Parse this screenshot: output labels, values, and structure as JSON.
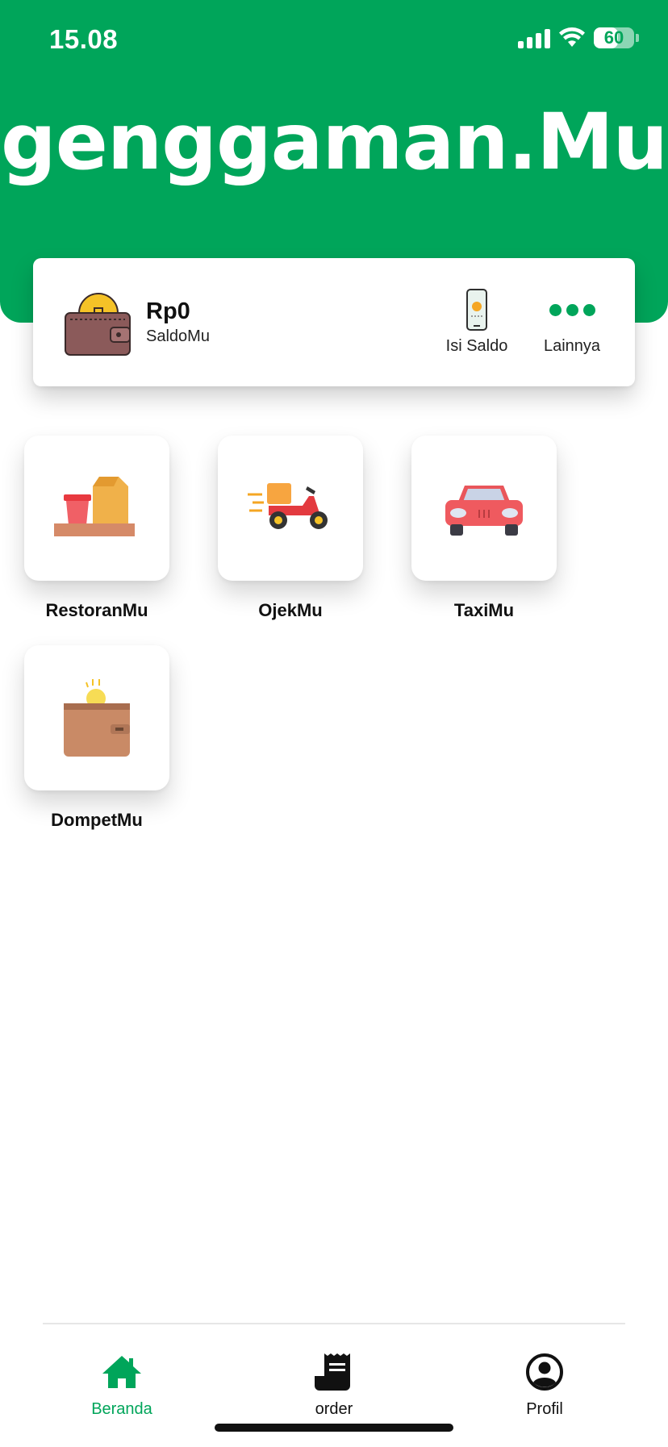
{
  "status_bar": {
    "time": "15.08",
    "battery": "60"
  },
  "header": {
    "logo_text": "genggaman.Mu"
  },
  "balance_card": {
    "amount": "Rp0",
    "label": "SaldoMu",
    "actions": [
      {
        "label": "Isi Saldo",
        "icon": "phone-topup-icon"
      },
      {
        "label": "Lainnya",
        "icon": "more-dots-icon"
      }
    ]
  },
  "services": [
    {
      "label": "RestoranMu",
      "icon": "restaurant-food-icon"
    },
    {
      "label": "OjekMu",
      "icon": "scooter-delivery-icon"
    },
    {
      "label": "TaxiMu",
      "icon": "car-icon"
    },
    {
      "label": "DompetMu",
      "icon": "wallet-coin-icon"
    }
  ],
  "bottom_nav": [
    {
      "label": "Beranda",
      "icon": "home-icon",
      "active": true
    },
    {
      "label": "order",
      "icon": "receipt-icon",
      "active": false
    },
    {
      "label": "Profil",
      "icon": "profile-icon",
      "active": false
    }
  ],
  "colors": {
    "brand_green": "#00a55a",
    "text": "#111111"
  }
}
